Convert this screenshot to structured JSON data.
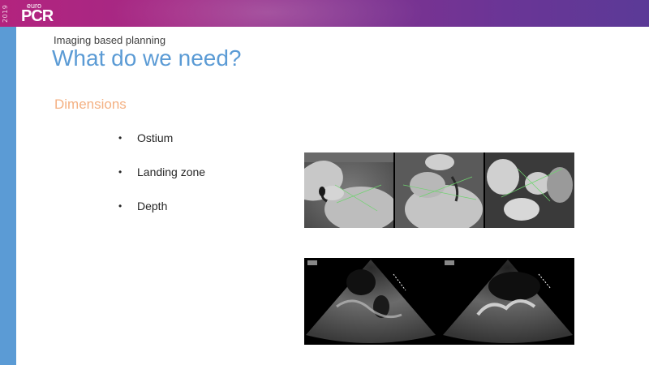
{
  "header": {
    "year": "2019",
    "logo_small": "euro",
    "logo_main": "PCR"
  },
  "slide": {
    "subtitle": "Imaging based planning",
    "title": "What do we need?",
    "section": "Dimensions",
    "bullets": [
      {
        "glyph": "•",
        "text": "Ostium"
      },
      {
        "glyph": "•",
        "text": "Landing zone"
      },
      {
        "glyph": "•",
        "text": "Depth"
      }
    ]
  },
  "colors": {
    "accent_blue": "#5b9bd5",
    "section_orange": "#f4b183",
    "banner_start": "#b3237e",
    "banner_end": "#5b3a97"
  },
  "images": {
    "ct_panels": [
      {
        "name": "ct-ostium-image"
      },
      {
        "name": "ct-landing-zone-image"
      },
      {
        "name": "ct-depth-image"
      }
    ],
    "echo_panels": [
      {
        "name": "echo-left-image"
      },
      {
        "name": "echo-right-image"
      }
    ]
  }
}
